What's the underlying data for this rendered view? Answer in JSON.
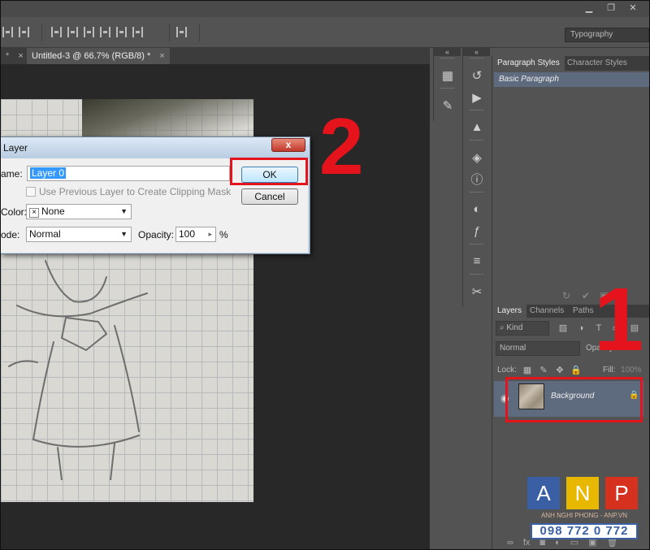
{
  "app": {
    "workspace": "Typography"
  },
  "document": {
    "tab_left_label": "*",
    "tab_title": "Untitled-3 @ 66.7% (RGB/8) *",
    "close_glyph": "×"
  },
  "dialog": {
    "title": "Layer",
    "name_label": "ame:",
    "name_value": "Layer 0",
    "clip_label": "Use Previous Layer to Create Clipping Mask",
    "color_label": "Color:",
    "color_value": "None",
    "color_swatch": "×",
    "mode_label": "ode:",
    "mode_value": "Normal",
    "opacity_label": "Opacity:",
    "opacity_value": "100",
    "opacity_unit": "%",
    "ok_label": "OK",
    "cancel_label": "Cancel",
    "close_glyph": "x"
  },
  "annotations": {
    "step1": "1",
    "step2": "2",
    "highlight_color": "#e5131b"
  },
  "paragraph_panel": {
    "tabs": [
      "Paragraph Styles",
      "Character Styles"
    ],
    "selected_item": "Basic Paragraph"
  },
  "layers_panel": {
    "tabs": [
      "Layers",
      "Channels",
      "Paths"
    ],
    "kind_label": "Kind",
    "blend_mode": "Normal",
    "opacity_label": "Opacity:",
    "lock_label": "Lock:",
    "fill_label": "Fill:",
    "fill_value": "100%",
    "layer_name": "Background"
  },
  "logo": {
    "letters": [
      "A",
      "N",
      "P"
    ],
    "tagline": "ANH NGHI PHONG - ANP.VN",
    "phone": "098 772 0 772",
    "colors": [
      "#3a5fa5",
      "#e8b800",
      "#d6301e"
    ]
  }
}
